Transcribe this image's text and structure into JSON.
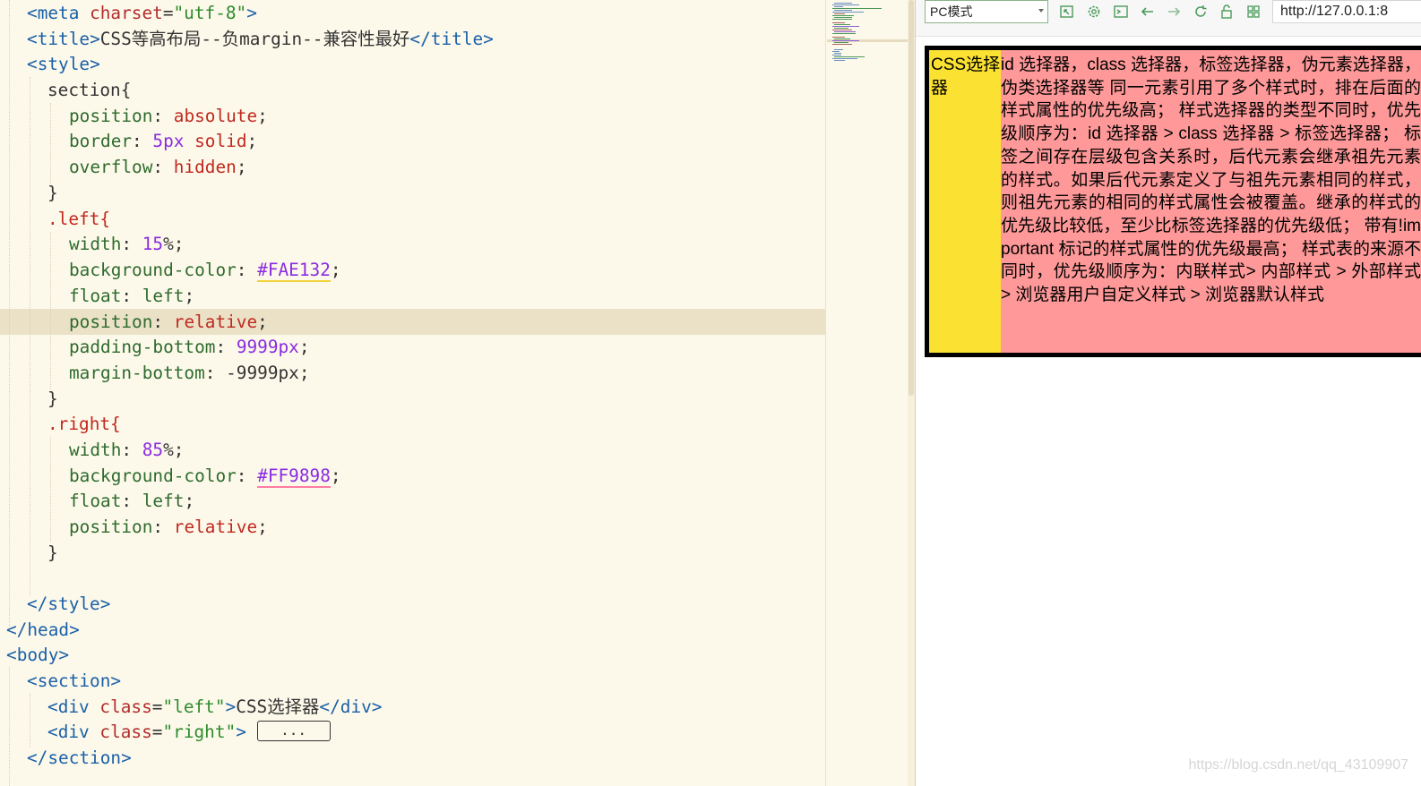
{
  "editor": {
    "line_meta": {
      "tag": "meta",
      "attr": "charset",
      "value": "\"utf-8\""
    },
    "line_title": {
      "open": "title",
      "text": "CSS等高布局--负margin--兼容性最好",
      "close": "title"
    },
    "tag_style": "style",
    "sel_section": "section{",
    "section_props": [
      {
        "prop": "position",
        "value": "absolute"
      },
      {
        "prop": "border",
        "num": "5px",
        "value": "solid"
      },
      {
        "prop": "overflow",
        "value": "hidden"
      }
    ],
    "brace_close": "}",
    "sel_left": ".left{",
    "left_props": {
      "width_prop": "width",
      "width_num": "15",
      "width_unit": "%",
      "bg_prop": "background-color",
      "bg_val": "#FAE132",
      "float_prop": "float",
      "float_val": "left",
      "pos_prop": "position",
      "pos_val": "relative",
      "pb_prop": "padding-bottom",
      "pb_val": "9999px",
      "mb_prop": "margin-bottom",
      "mb_val": "-9999px"
    },
    "sel_right": ".right{",
    "right_props": {
      "width_prop": "width",
      "width_num": "85",
      "width_unit": "%",
      "bg_prop": "background-color",
      "bg_val": "#FF9898",
      "float_prop": "float",
      "float_val": "left",
      "pos_prop": "position",
      "pos_val": "relative"
    },
    "close_style": "style",
    "close_head": "head",
    "open_body": "body",
    "open_section": "section",
    "div_left": {
      "tag": "div",
      "attr": "class",
      "val": "\"left\"",
      "text": "CSS选择器",
      "close": "div"
    },
    "div_right": {
      "tag": "div",
      "attr": "class",
      "val": "\"right\"",
      "fold": "..."
    },
    "close_section": "section"
  },
  "preview": {
    "mode_select": "PC模式",
    "url": "http://127.0.0.1:8",
    "icons": [
      "external-window-icon",
      "settings-gear-icon",
      "console-icon",
      "back-arrow-icon",
      "forward-arrow-icon",
      "reload-icon",
      "lock-icon",
      "grid-icon"
    ],
    "left_text": "CSS选择器",
    "right_text": "id 选择器，class 选择器，标签选择器，伪元素选择器，伪类选择器等 同一元素引用了多个样式时，排在后面的样式属性的优先级高； 样式选择器的类型不同时，优先级顺序为：id 选择器 > class 选择器 > 标签选择器； 标签之间存在层级包含关系时，后代元素会继承祖先元素的样式。如果后代元素定义了与祖先元素相同的样式，则祖先元素的相同的样式属性会被覆盖。继承的样式的优先级比较低，至少比标签选择器的优先级低； 带有!important 标记的样式属性的优先级最高； 样式表的来源不同时，优先级顺序为：内联样式> 内部样式 > 外部样式 > 浏览器用户自定义样式 > 浏览器默认样式",
    "left_color": "#FAE132",
    "right_color": "#FF9898"
  },
  "watermark": "https://blog.csdn.net/qq_43109907"
}
